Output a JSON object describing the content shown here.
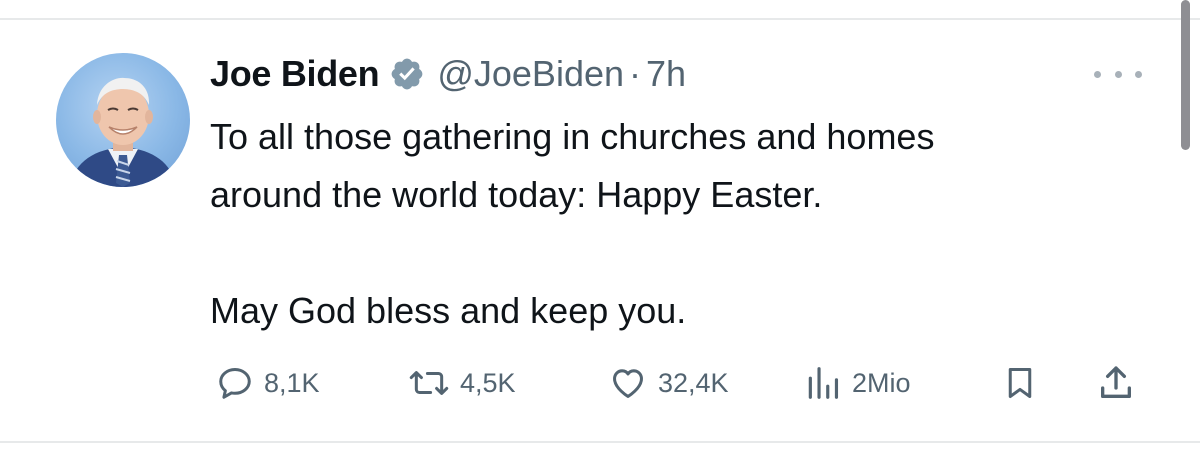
{
  "tweet": {
    "author_name": "Joe Biden",
    "handle": "@JoeBiden",
    "separator": "·",
    "time": "7h",
    "text": "To all those gathering in churches and homes\naround the world today: Happy Easter.\n\nMay God bless and keep you.",
    "avatar_icon": "profile-photo",
    "verified_icon": "verified-badge-icon",
    "more_icon": "more-options-icon"
  },
  "actions": {
    "replies": {
      "icon": "reply-icon",
      "count": "8,1K"
    },
    "reposts": {
      "icon": "repost-icon",
      "count": "4,5K"
    },
    "likes": {
      "icon": "heart-icon",
      "count": "32,4K"
    },
    "views": {
      "icon": "views-chart-icon",
      "count": "2Mio"
    },
    "bookmark": {
      "icon": "bookmark-icon"
    },
    "share": {
      "icon": "share-icon"
    }
  },
  "colors": {
    "text": "#0f1419",
    "secondary": "#536471",
    "divider": "#e7e9ea",
    "verified_badge": "#829aab"
  }
}
